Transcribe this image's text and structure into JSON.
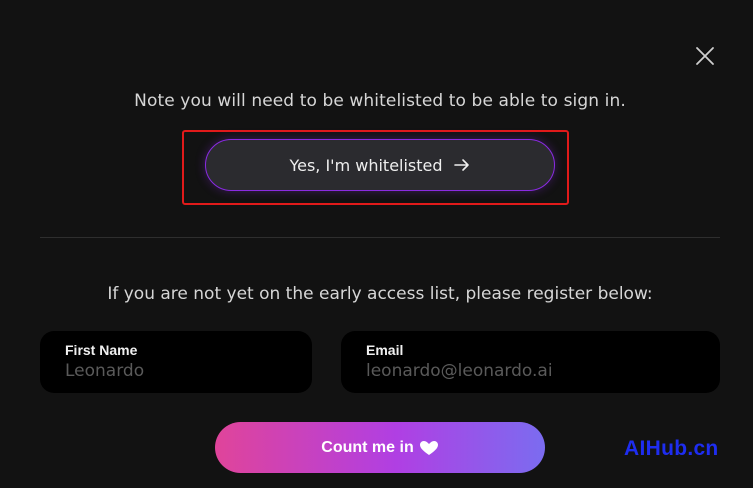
{
  "modal": {
    "close_icon": "close-icon",
    "note": "Note you will need to be whitelisted to be able to sign in.",
    "whitelist_button": {
      "label": "Yes, I'm whitelisted",
      "icon": "arrow-right-icon"
    },
    "register_text": "If you are not yet on the early access list, please register below:",
    "form": {
      "first_name": {
        "label": "First Name",
        "value": "",
        "placeholder": "Leonardo"
      },
      "email": {
        "label": "Email",
        "value": "",
        "placeholder": "leonardo@leonardo.ai"
      }
    },
    "submit_button": {
      "label": "Count me in",
      "icon": "heart-icon"
    }
  },
  "watermark": "AIHub.cn",
  "colors": {
    "background": "#121212",
    "accent_purple": "#8a2be2",
    "highlight_red": "#e11a1a",
    "gradient_start": "#e0449a",
    "gradient_end": "#7b6cf0",
    "watermark_blue": "#1e2df0"
  }
}
